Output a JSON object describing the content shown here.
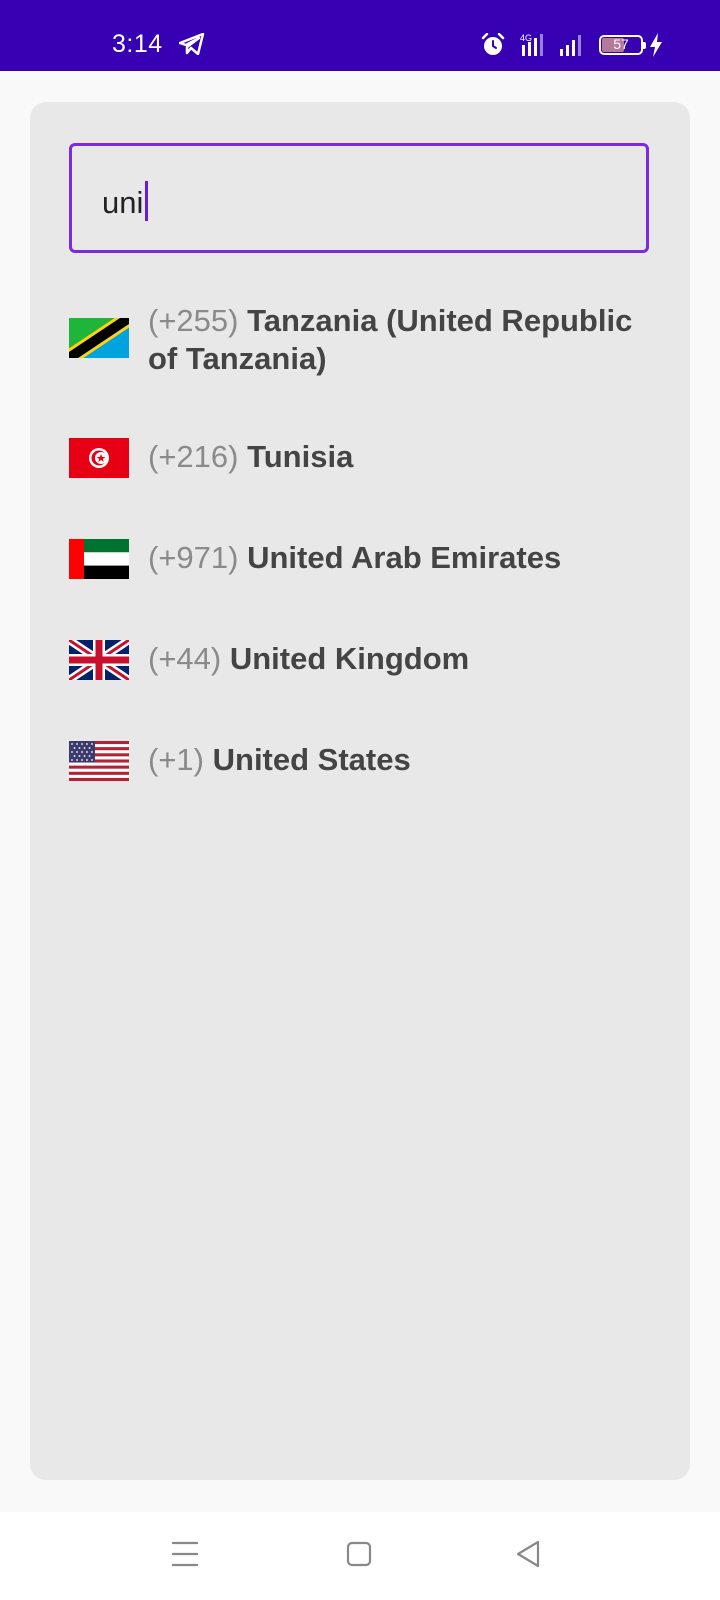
{
  "status_bar": {
    "time": "3:14",
    "battery_percent": "57",
    "battery_level": 0.57,
    "network_type": "4G",
    "icons": [
      "telegram-icon",
      "alarm-icon",
      "signal-4g-icon",
      "signal-icon",
      "battery-icon",
      "charging-bolt-icon"
    ],
    "background_color": "#3700b3"
  },
  "search": {
    "value": "uni",
    "border_color": "#7b2ae0"
  },
  "countries": [
    {
      "dial_code": "(+255)",
      "name": "Tanzania (United Republic of Tanzania)",
      "flag": "tanzania-flag-icon"
    },
    {
      "dial_code": "(+216)",
      "name": "Tunisia",
      "flag": "tunisia-flag-icon"
    },
    {
      "dial_code": "(+971)",
      "name": "United Arab Emirates",
      "flag": "uae-flag-icon"
    },
    {
      "dial_code": "(+44)",
      "name": "United Kingdom",
      "flag": "uk-flag-icon"
    },
    {
      "dial_code": "(+1)",
      "name": "United States",
      "flag": "us-flag-icon"
    }
  ],
  "nav_bar": {
    "icons": [
      "menu-icon",
      "home-icon",
      "back-icon"
    ]
  }
}
